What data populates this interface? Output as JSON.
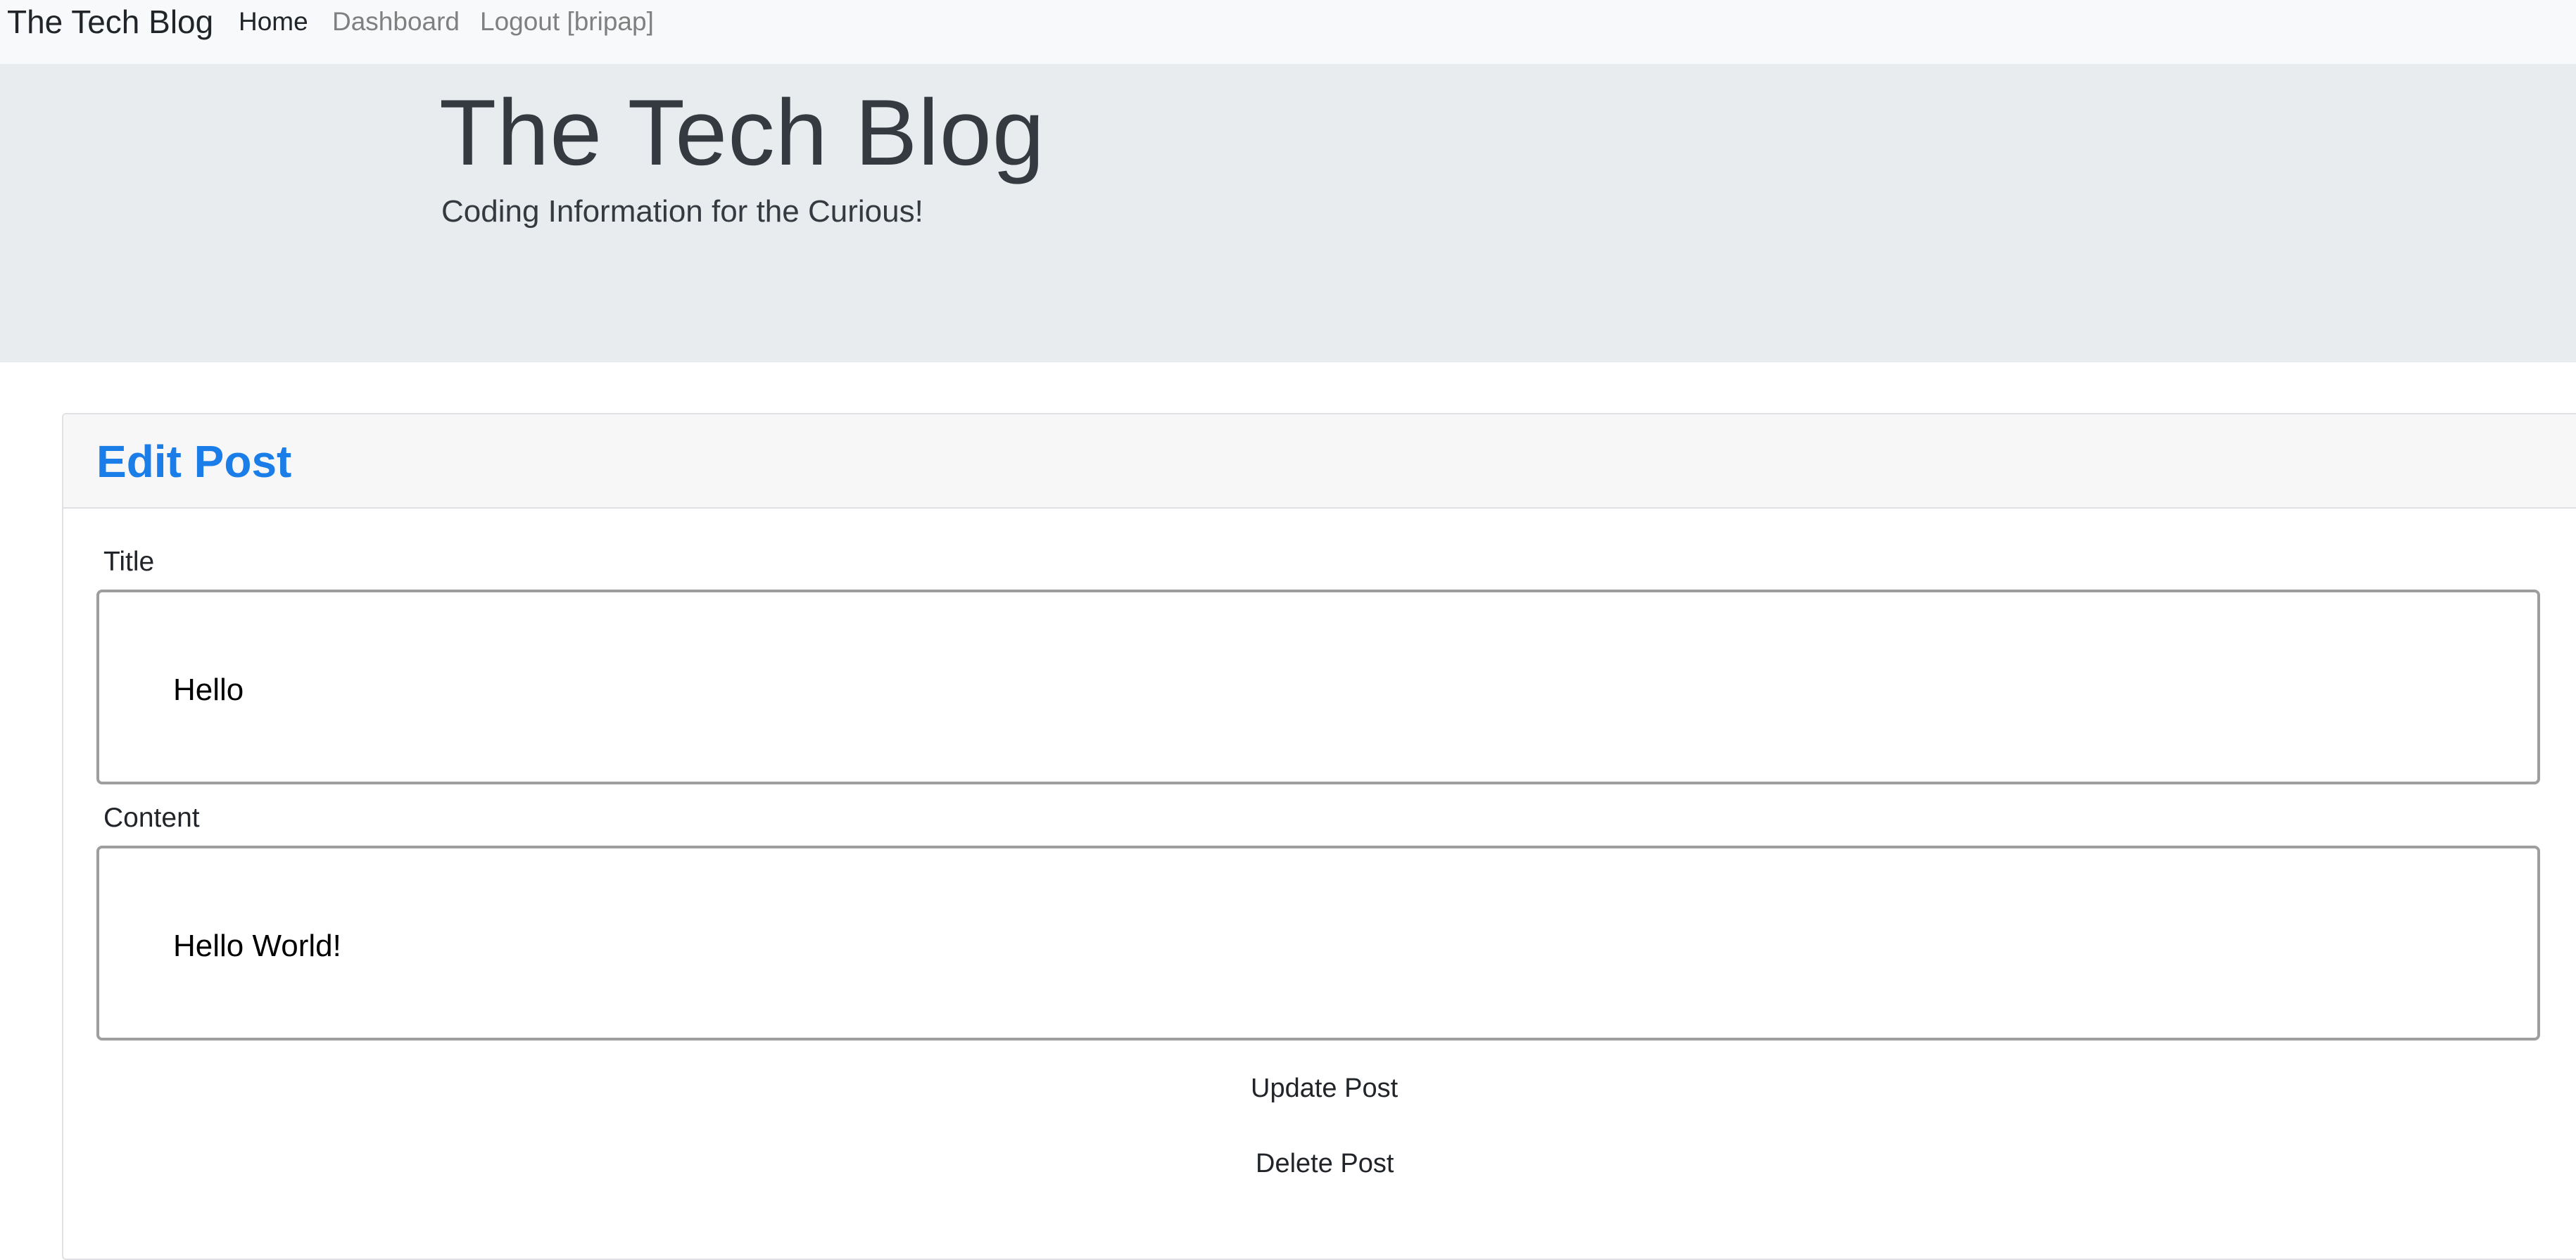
{
  "navbar": {
    "brand": "The Tech Blog",
    "links": [
      {
        "label": "Home",
        "active": true
      },
      {
        "label": "Dashboard",
        "active": false
      },
      {
        "label": "Logout [bripap]",
        "active": false
      }
    ]
  },
  "jumbotron": {
    "title": "The Tech Blog",
    "subtitle": "Coding Information for the Curious!"
  },
  "edit_post": {
    "header": "Edit Post",
    "title_label": "Title",
    "title_value": "Hello",
    "content_label": "Content",
    "content_value": "Hello World!",
    "update_label": "Update Post",
    "delete_label": "Delete Post"
  },
  "colors": {
    "accent": "#1a7de8",
    "navbar_bg": "#f8f9fa",
    "jumbotron_bg": "#e9ecef",
    "muted_link": "#808080"
  }
}
